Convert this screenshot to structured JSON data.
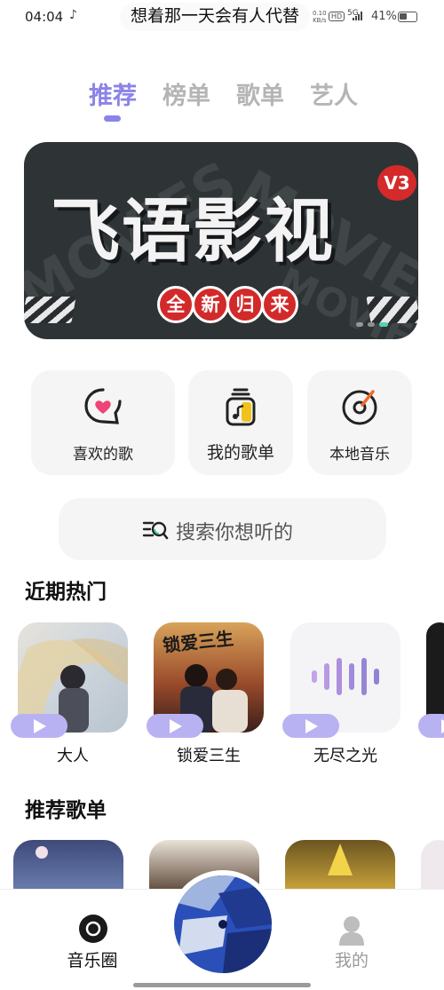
{
  "status_bar": {
    "time": "04:04",
    "tiktok_glyph": "♪",
    "lyric": "想着那一天会有人代替",
    "net_speed_value": "0.10",
    "net_speed_unit": "KB/s",
    "hd": "HD",
    "signal": "5G",
    "battery": "41%"
  },
  "tabs": [
    {
      "label": "推荐",
      "active": true
    },
    {
      "label": "榜单",
      "active": false
    },
    {
      "label": "歌单",
      "active": false
    },
    {
      "label": "艺人",
      "active": false
    }
  ],
  "banner": {
    "title": "飞语影视",
    "badge": "V3",
    "slogan": [
      "全",
      "新",
      "归",
      "来"
    ],
    "background_word": "MOVIES",
    "page_count": 3,
    "active_page": 3
  },
  "quick_access": [
    {
      "label": "喜欢的歌",
      "icon": "heart-chat-icon"
    },
    {
      "label": "我的歌单",
      "icon": "music-jar-icon"
    },
    {
      "label": "本地音乐",
      "icon": "vinyl-record-icon"
    }
  ],
  "search": {
    "placeholder": "搜索你想听的",
    "icon": "search-list-icon"
  },
  "sections": {
    "hot": "近期热门",
    "playlists": "推荐歌单"
  },
  "hot_items": [
    {
      "label": "大人"
    },
    {
      "label": "锁爱三生",
      "cover_text": "锁爱三生"
    },
    {
      "label": "无尽之光"
    }
  ],
  "bottom_nav": [
    {
      "label": "音乐圈",
      "icon": "disc-icon",
      "active": true
    },
    {
      "label": "我的",
      "icon": "user-icon",
      "active": false
    }
  ],
  "colors": {
    "accent": "#8b83e8",
    "play_pill": "#b9b2f2",
    "badge_red": "#d22a2a",
    "indicator_teal": "#4fd4b9"
  }
}
